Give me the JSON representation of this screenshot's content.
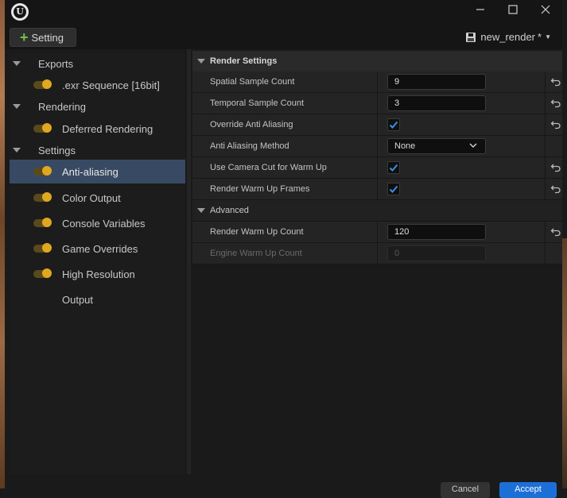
{
  "toolbar": {
    "add_setting_label": "Setting",
    "preset_name": "new_render",
    "modified_mark": "*"
  },
  "sidebar": {
    "exports_label": "Exports",
    "exports_items": [
      ".exr Sequence [16bit]"
    ],
    "rendering_label": "Rendering",
    "rendering_items": [
      "Deferred Rendering"
    ],
    "settings_label": "Settings",
    "settings_items": [
      "Anti-aliasing",
      "Color Output",
      "Console Variables",
      "Game Overrides",
      "High Resolution",
      "Output"
    ]
  },
  "details": {
    "section_label": "Render Settings",
    "spatial_sample_count": {
      "label": "Spatial Sample Count",
      "value": "9"
    },
    "temporal_sample_count": {
      "label": "Temporal Sample Count",
      "value": "3"
    },
    "override_anti_aliasing": {
      "label": "Override Anti Aliasing",
      "checked": true
    },
    "anti_aliasing_method": {
      "label": "Anti Aliasing Method",
      "value": "None"
    },
    "use_camera_cut": {
      "label": "Use Camera Cut for Warm Up",
      "checked": true
    },
    "render_warm_up_frames": {
      "label": "Render Warm Up Frames",
      "checked": true
    },
    "advanced_label": "Advanced",
    "render_warm_up_count": {
      "label": "Render Warm Up Count",
      "value": "120"
    },
    "engine_warm_up_count": {
      "label": "Engine Warm Up Count",
      "value": "0"
    }
  },
  "footer": {
    "cancel_label": "Cancel",
    "accept_label": "Accept"
  },
  "colors": {
    "accent": "#1d6fd8",
    "toggle_on": "#e0a820",
    "selected_row": "#384a63",
    "check": "#3d8ee8"
  }
}
